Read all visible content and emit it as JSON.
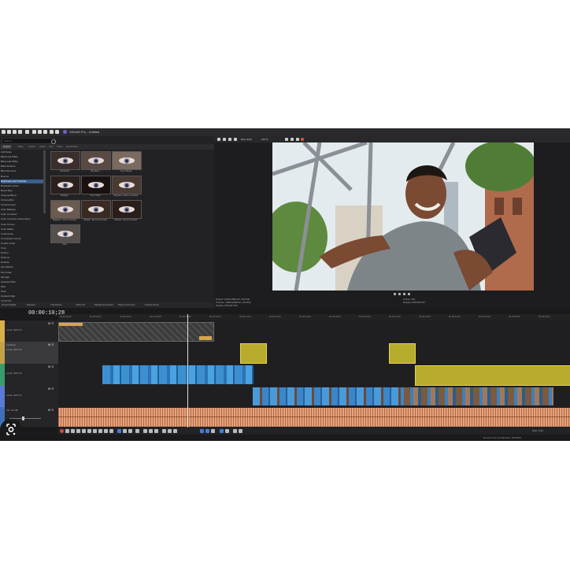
{
  "app": {
    "title": "VEGAS Pro - Untitled"
  },
  "fx_panel": {
    "search_placeholder": "Search...",
    "tabs": [
      "Project",
      "Video",
      "Colour",
      "Audio",
      "Text",
      "Trans",
      "Generators"
    ],
    "active_tab": "Project",
    "list_items": [
      "Add Noise",
      "Black and White",
      "Black and White",
      "Black Restore",
      "Block Remove",
      "Bounce",
      "Brightness and Contrast",
      "Broadcast Colour",
      "Bump Map",
      "Channel Blend",
      "Chroma Blur",
      "Chroma Keyer",
      "Color Balance",
      "Color Corrector",
      "Color Corrector (Secondary)",
      "Color Curves",
      "Color Match",
      "Colorimetric",
      "Convolution Kernel",
      "Cookie Cutter",
      "Crop",
      "Deform",
      "Defocus",
      "Emboss",
      "Film Effects",
      "Film Grain",
      "Fill Light",
      "Gaussian Blur",
      "Glint",
      "Glow",
      "Gradient Map",
      "Immersive"
    ],
    "selected_index": 6,
    "presets": [
      {
        "label": "(Default)"
      },
      {
        "label": "Brighten"
      },
      {
        "label": "Very Bright"
      },
      {
        "label": "Darken"
      },
      {
        "label": "Very Dark"
      },
      {
        "label": "Brighter, More Contrast"
      },
      {
        "label": "Brighter, Less Contrast"
      },
      {
        "label": "Darker, More Contrast"
      },
      {
        "label": "Darker, Less Contrast"
      },
      {
        "label": "Flat"
      }
    ]
  },
  "viewer": {
    "preview_mode": "Best (Full)",
    "zoom": "100 %",
    "info_project": "Project: 1920x1080x32, 29.970p",
    "info_preview": "Preview: 1920x1080x32, 29.970p",
    "info_display": "Display: 652x367x32",
    "frame_label": "Frame: 320",
    "display_label": "Display: 652x367x32"
  },
  "panel_tabs": [
    "Project Media",
    "Explorer",
    "Transitions",
    "Video FX",
    "Media Generators",
    "Plug-In Chooser",
    "Project Notes"
  ],
  "timeline": {
    "timecode": "00:00:10;28",
    "ruler": [
      "00:00:00;00",
      "00:00:02;00",
      "00:00:04;00",
      "00:00:06;00",
      "00:00:08;00",
      "00:00:10;00",
      "00:00:12;00",
      "00:00:14;00",
      "00:00:16;00",
      "00:00:18;00",
      "00:00:20;00",
      "00:00:22;00",
      "00:00:24;00",
      "00:00:26;00",
      "00:00:28;00",
      "00:00:30;00",
      "00:00:32;00"
    ],
    "tracks": [
      {
        "name": "Level: 100.0 %",
        "ms": "M S"
      },
      {
        "name": "Level: 100.0 %",
        "ms": "M S"
      },
      {
        "name": "Level: 100.0 %",
        "ms": "M S"
      },
      {
        "name": "Level: 100.0 %",
        "ms": "M S"
      },
      {
        "name": "Vol: 0.0 dB",
        "ms": "M S"
      }
    ],
    "title_clip": "Freeform",
    "rate": "Rate: 0.00",
    "record_time": "Record Time (2 channels): 99:08:20"
  },
  "colors": {
    "selection": "#3a5f8f",
    "audio": "#e8a27a",
    "yellow_clip": "#b7ac2d",
    "transport_active": "#3f7fd6"
  }
}
